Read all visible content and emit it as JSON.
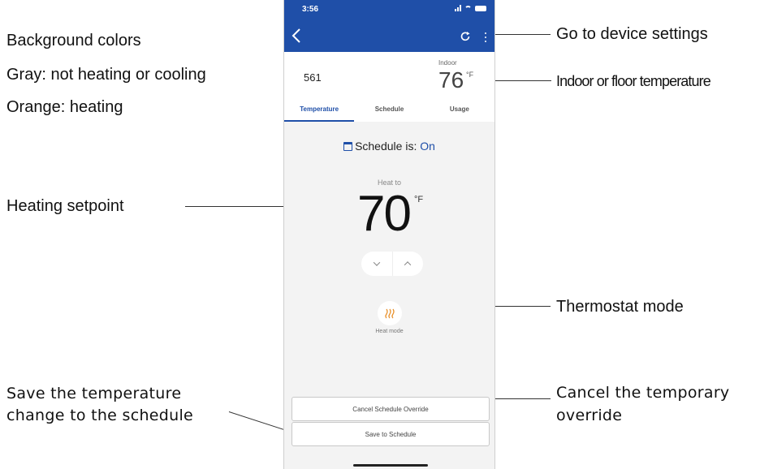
{
  "annotations": {
    "background_colors": "Background colors",
    "gray_note": "Gray: not heating or cooling",
    "orange_note": "Orange: heating",
    "heating_setpoint": "Heating setpoint",
    "save_note_line1": "Save the temperature",
    "save_note_line2": "change to the schedule",
    "device_settings": "Go to device settings",
    "indoor_temp": "Indoor or floor temperature",
    "thermostat_mode": "Thermostat mode",
    "cancel_note_line1": "Cancel the temporary",
    "cancel_note_line2": "override"
  },
  "phone": {
    "status_time": "3:56",
    "device_name": "561",
    "indoor_label": "Indoor",
    "indoor_temp": "76",
    "temp_unit": "°F",
    "tabs": [
      {
        "label": "Temperature",
        "active": true
      },
      {
        "label": "Schedule",
        "active": false
      },
      {
        "label": "Usage",
        "active": false
      }
    ],
    "schedule_label": "Schedule is:",
    "schedule_value": "On",
    "heat_to_label": "Heat to",
    "setpoint": "70",
    "setpoint_unit": "°F",
    "mode_label": "Heat mode",
    "cancel_override_label": "Cancel Schedule Override",
    "save_schedule_label": "Save to Schedule"
  },
  "colors": {
    "app_bar": "#1f4fa8",
    "accent": "#1f4fa8",
    "heat_icon": "#e8902a",
    "background_gray": "#f3f3f3"
  },
  "icons": {
    "back": "back-arrow-icon",
    "refresh": "refresh-icon",
    "menu": "more-vertical-icon",
    "calendar": "calendar-icon",
    "heat": "heat-waves-icon"
  }
}
